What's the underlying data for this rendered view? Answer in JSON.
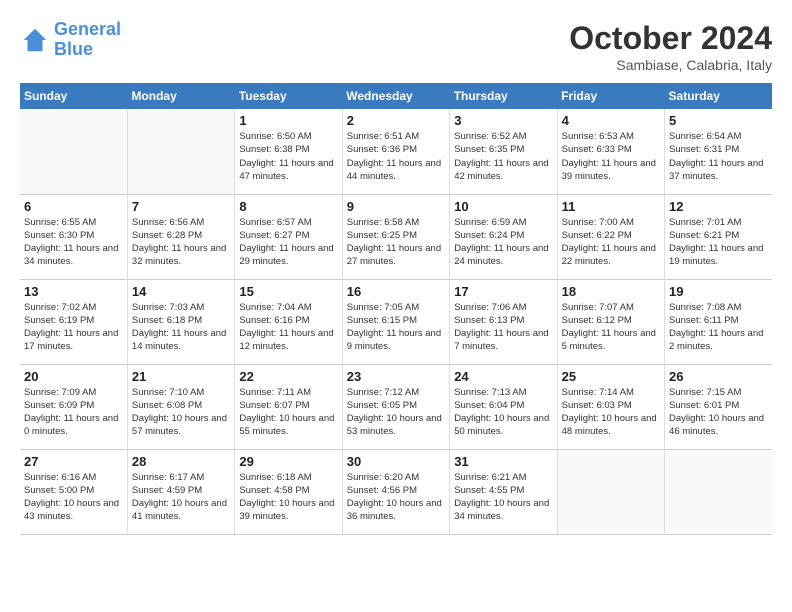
{
  "logo": {
    "line1": "General",
    "line2": "Blue"
  },
  "title": "October 2024",
  "subtitle": "Sambiase, Calabria, Italy",
  "days_of_week": [
    "Sunday",
    "Monday",
    "Tuesday",
    "Wednesday",
    "Thursday",
    "Friday",
    "Saturday"
  ],
  "weeks": [
    [
      {
        "day": "",
        "info": ""
      },
      {
        "day": "",
        "info": ""
      },
      {
        "day": "1",
        "info": "Sunrise: 6:50 AM\nSunset: 6:38 PM\nDaylight: 11 hours and 47 minutes."
      },
      {
        "day": "2",
        "info": "Sunrise: 6:51 AM\nSunset: 6:36 PM\nDaylight: 11 hours and 44 minutes."
      },
      {
        "day": "3",
        "info": "Sunrise: 6:52 AM\nSunset: 6:35 PM\nDaylight: 11 hours and 42 minutes."
      },
      {
        "day": "4",
        "info": "Sunrise: 6:53 AM\nSunset: 6:33 PM\nDaylight: 11 hours and 39 minutes."
      },
      {
        "day": "5",
        "info": "Sunrise: 6:54 AM\nSunset: 6:31 PM\nDaylight: 11 hours and 37 minutes."
      }
    ],
    [
      {
        "day": "6",
        "info": "Sunrise: 6:55 AM\nSunset: 6:30 PM\nDaylight: 11 hours and 34 minutes."
      },
      {
        "day": "7",
        "info": "Sunrise: 6:56 AM\nSunset: 6:28 PM\nDaylight: 11 hours and 32 minutes."
      },
      {
        "day": "8",
        "info": "Sunrise: 6:57 AM\nSunset: 6:27 PM\nDaylight: 11 hours and 29 minutes."
      },
      {
        "day": "9",
        "info": "Sunrise: 6:58 AM\nSunset: 6:25 PM\nDaylight: 11 hours and 27 minutes."
      },
      {
        "day": "10",
        "info": "Sunrise: 6:59 AM\nSunset: 6:24 PM\nDaylight: 11 hours and 24 minutes."
      },
      {
        "day": "11",
        "info": "Sunrise: 7:00 AM\nSunset: 6:22 PM\nDaylight: 11 hours and 22 minutes."
      },
      {
        "day": "12",
        "info": "Sunrise: 7:01 AM\nSunset: 6:21 PM\nDaylight: 11 hours and 19 minutes."
      }
    ],
    [
      {
        "day": "13",
        "info": "Sunrise: 7:02 AM\nSunset: 6:19 PM\nDaylight: 11 hours and 17 minutes."
      },
      {
        "day": "14",
        "info": "Sunrise: 7:03 AM\nSunset: 6:18 PM\nDaylight: 11 hours and 14 minutes."
      },
      {
        "day": "15",
        "info": "Sunrise: 7:04 AM\nSunset: 6:16 PM\nDaylight: 11 hours and 12 minutes."
      },
      {
        "day": "16",
        "info": "Sunrise: 7:05 AM\nSunset: 6:15 PM\nDaylight: 11 hours and 9 minutes."
      },
      {
        "day": "17",
        "info": "Sunrise: 7:06 AM\nSunset: 6:13 PM\nDaylight: 11 hours and 7 minutes."
      },
      {
        "day": "18",
        "info": "Sunrise: 7:07 AM\nSunset: 6:12 PM\nDaylight: 11 hours and 5 minutes."
      },
      {
        "day": "19",
        "info": "Sunrise: 7:08 AM\nSunset: 6:11 PM\nDaylight: 11 hours and 2 minutes."
      }
    ],
    [
      {
        "day": "20",
        "info": "Sunrise: 7:09 AM\nSunset: 6:09 PM\nDaylight: 11 hours and 0 minutes."
      },
      {
        "day": "21",
        "info": "Sunrise: 7:10 AM\nSunset: 6:08 PM\nDaylight: 10 hours and 57 minutes."
      },
      {
        "day": "22",
        "info": "Sunrise: 7:11 AM\nSunset: 6:07 PM\nDaylight: 10 hours and 55 minutes."
      },
      {
        "day": "23",
        "info": "Sunrise: 7:12 AM\nSunset: 6:05 PM\nDaylight: 10 hours and 53 minutes."
      },
      {
        "day": "24",
        "info": "Sunrise: 7:13 AM\nSunset: 6:04 PM\nDaylight: 10 hours and 50 minutes."
      },
      {
        "day": "25",
        "info": "Sunrise: 7:14 AM\nSunset: 6:03 PM\nDaylight: 10 hours and 48 minutes."
      },
      {
        "day": "26",
        "info": "Sunrise: 7:15 AM\nSunset: 6:01 PM\nDaylight: 10 hours and 46 minutes."
      }
    ],
    [
      {
        "day": "27",
        "info": "Sunrise: 6:16 AM\nSunset: 5:00 PM\nDaylight: 10 hours and 43 minutes."
      },
      {
        "day": "28",
        "info": "Sunrise: 6:17 AM\nSunset: 4:59 PM\nDaylight: 10 hours and 41 minutes."
      },
      {
        "day": "29",
        "info": "Sunrise: 6:18 AM\nSunset: 4:58 PM\nDaylight: 10 hours and 39 minutes."
      },
      {
        "day": "30",
        "info": "Sunrise: 6:20 AM\nSunset: 4:56 PM\nDaylight: 10 hours and 36 minutes."
      },
      {
        "day": "31",
        "info": "Sunrise: 6:21 AM\nSunset: 4:55 PM\nDaylight: 10 hours and 34 minutes."
      },
      {
        "day": "",
        "info": ""
      },
      {
        "day": "",
        "info": ""
      }
    ]
  ]
}
